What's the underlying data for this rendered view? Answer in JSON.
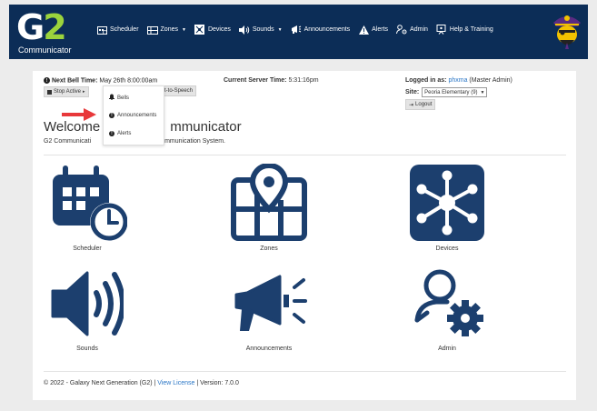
{
  "brand": {
    "logo_g": "G",
    "logo_two": "2",
    "logo_subtitle": "Communicator"
  },
  "nav": {
    "items": [
      {
        "label": "Scheduler",
        "icon": "calendar-icon"
      },
      {
        "label": "Zones",
        "icon": "zones-map-icon",
        "dropdown": true
      },
      {
        "label": "Devices",
        "icon": "devices-icon"
      },
      {
        "label": "Sounds",
        "icon": "speaker-icon",
        "dropdown": true
      },
      {
        "label": "Announcements",
        "icon": "megaphone-icon"
      },
      {
        "label": "Alerts",
        "icon": "warning-icon"
      },
      {
        "label": "Admin",
        "icon": "admin-gear-icon"
      },
      {
        "label": "Help & Training",
        "icon": "help-icon"
      }
    ]
  },
  "status": {
    "next_bell_label": "Next Bell Time:",
    "next_bell_value": "May 26th 8:00:00am",
    "server_time_label": "Current Server Time:",
    "server_time_value": "5:31:16pm",
    "logged_in_label": "Logged in as:",
    "logged_in_user": "phxma",
    "logged_in_role": "(Master Admin)",
    "site_label": "Site:",
    "site_value": "Peoria Elementary (9)",
    "logout_label": "Logout",
    "stop_active_label": "Stop Active",
    "tts_label": "xt-to-Speech"
  },
  "dropdown_menu": {
    "items": [
      {
        "label": "Bells",
        "icon": "bell-icon"
      },
      {
        "label": "Announcements",
        "icon": "info-circle-icon"
      },
      {
        "label": "Alerts",
        "icon": "info-circle-icon"
      }
    ]
  },
  "welcome": {
    "title_left": "Welcome",
    "title_right": "mmunicator",
    "subtitle_left": "G2 Communicati",
    "subtitle_right": "Communication System."
  },
  "tiles": [
    {
      "label": "Scheduler",
      "icon": "calendar-clock-icon"
    },
    {
      "label": "Zones",
      "icon": "zones-map-pin-icon"
    },
    {
      "label": "Devices",
      "icon": "network-hub-icon"
    },
    {
      "label": "Sounds",
      "icon": "speaker-volume-icon"
    },
    {
      "label": "Announcements",
      "icon": "megaphone-large-icon"
    },
    {
      "label": "Admin",
      "icon": "user-gear-icon"
    }
  ],
  "footer": {
    "copyright": "© 2022 - Galaxy Next Generation (G2) |",
    "license_link": "View License",
    "version": "| Version: 7.0.0"
  },
  "colors": {
    "navbar": "#0c2d57",
    "icon_blue": "#1c3f6e",
    "accent_green": "#9bd33c",
    "link_blue": "#2a76c6",
    "arrow_red": "#e8383a"
  }
}
